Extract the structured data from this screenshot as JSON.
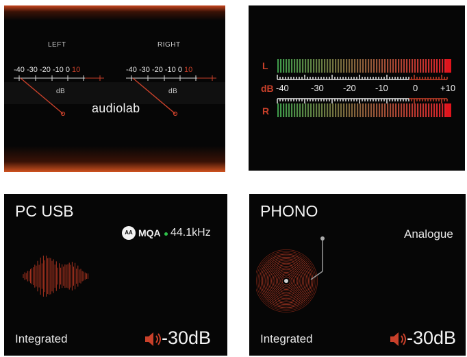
{
  "analog_meter": {
    "left_label": "LEFT",
    "right_label": "RIGHT",
    "scale_white": "-40 -30 -20 -10 0",
    "scale_red": "10",
    "unit": "dB",
    "brand": "audiolab",
    "colors": {
      "accent": "#c8402a",
      "glow": "#d0521f"
    }
  },
  "bar_meter": {
    "left_channel": "L",
    "right_channel": "R",
    "unit": "dB",
    "ticks": [
      "-40",
      "-30",
      "-20",
      "-10",
      "0",
      "+10"
    ],
    "level_left": 1.0,
    "level_right": 1.0,
    "colors": {
      "low": "#3f9a4a",
      "high": "#d8232a"
    }
  },
  "usb_screen": {
    "title": "PC USB",
    "format_logo": "MQA",
    "sample_rate": "44.1kHz",
    "mode": "Integrated",
    "volume": "-30dB",
    "icons": [
      "mqa-logo-icon",
      "mqa-indicator-dot-icon",
      "waveform-icon",
      "speaker-icon"
    ],
    "colors": {
      "indicator": "#2fc24a"
    }
  },
  "phono_screen": {
    "title": "PHONO",
    "signal": "Analogue",
    "mode": "Integrated",
    "volume": "-30dB",
    "icons": [
      "turntable-icon",
      "speaker-icon"
    ]
  }
}
